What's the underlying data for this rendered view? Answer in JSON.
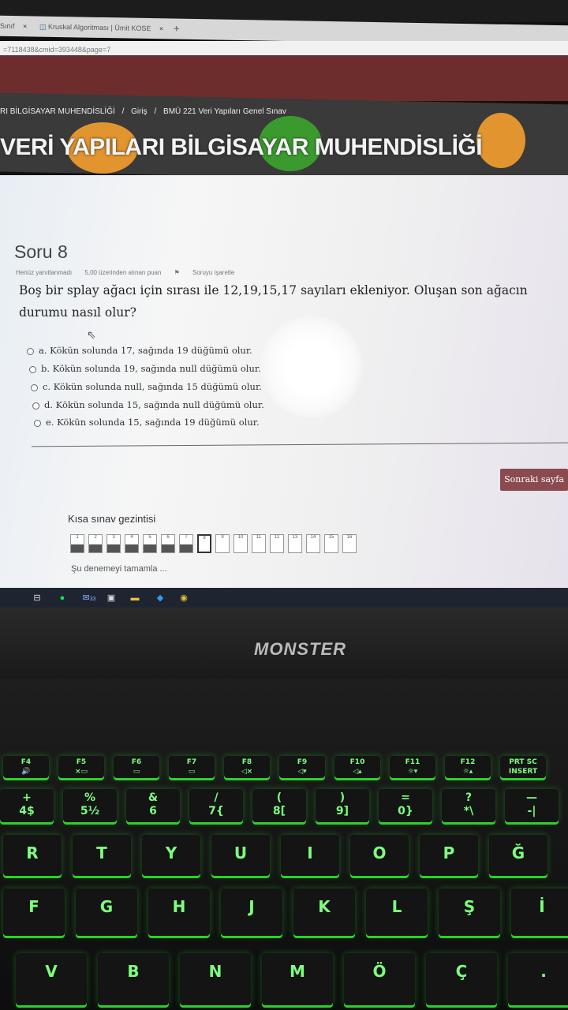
{
  "browser": {
    "tabs": [
      {
        "label": "Sınıf",
        "close": "×"
      },
      {
        "label": "Kruskal Algoritması | Ümit KOSE",
        "close": "×"
      }
    ],
    "new_tab": "+",
    "url": "=7118438&cmid=393448&page=7"
  },
  "header": {
    "breadcrumb": [
      "RI BİLGİSAYAR MUHENDİSLİĞİ",
      "/",
      "Giriş",
      "/",
      "BMÜ 221 Veri Yapıları Genel Sınav"
    ],
    "course_title": "VERİ YAPILARI BİLGİSAYAR MUHENDİSLİĞİ"
  },
  "question": {
    "title": "Soru 8",
    "status": "Henüz yanıtlanmadı",
    "points": "5,00 üzerinden alınan puan",
    "flag": "Soruyu işaretle",
    "text": "Boş bir splay ağacı için sırası ile 12,19,15,17 sayıları ekleniyor. Oluşan son ağacın durumu nasıl olur?",
    "options": [
      "a. Kökün solunda 17, sağında 19 düğümü olur.",
      "b. Kökün solunda 19, sağında null düğümü olur.",
      "c. Kökün solunda null, sağında 15 düğümü olur.",
      "d. Kökün solunda 15, sağında null düğümü olur.",
      "e. Kökün solunda 15, sağında 19 düğümü olur."
    ]
  },
  "next_button": "Sonraki sayfa",
  "quiz_nav": {
    "title": "Kısa sınav gezintisi",
    "items": [
      "1",
      "2",
      "3",
      "4",
      "5",
      "6",
      "7",
      "8",
      "9",
      "10",
      "11",
      "12",
      "13",
      "14",
      "15",
      "16"
    ],
    "answered_count": 7,
    "current": "8",
    "finish_link": "Şu denemeyi tamamla ..."
  },
  "taskbar": {
    "icons": [
      "task-view-icon",
      "spotify-icon",
      "mail-icon",
      "store-icon",
      "file-explorer-icon",
      "vscode-icon",
      "chrome-icon"
    ],
    "mail_badge": "33"
  },
  "laptop": {
    "brand": "MONSTER",
    "fkeys": [
      {
        "top": "F4",
        "bottom": "🔊"
      },
      {
        "top": "F5",
        "bottom": "×▭"
      },
      {
        "top": "F6",
        "bottom": "▭"
      },
      {
        "top": "F7",
        "bottom": "▭"
      },
      {
        "top": "F8",
        "bottom": "◁×"
      },
      {
        "top": "F9",
        "bottom": "◁▾"
      },
      {
        "top": "F10",
        "bottom": "◁▴"
      },
      {
        "top": "F11",
        "bottom": "☼▾"
      },
      {
        "top": "F12",
        "bottom": "☼▴"
      },
      {
        "top": "PRT SC",
        "bottom": "INSERT"
      }
    ],
    "num_keys": [
      {
        "top": "+",
        "bottom": "4$"
      },
      {
        "top": "%",
        "bottom": "5½"
      },
      {
        "top": "&",
        "bottom": "6"
      },
      {
        "top": "/",
        "bottom": "7{"
      },
      {
        "top": "(",
        "bottom": "8["
      },
      {
        "top": ")",
        "bottom": "9]"
      },
      {
        "top": "=",
        "bottom": "0}"
      },
      {
        "top": "?",
        "bottom": "*\\"
      },
      {
        "top": "—",
        "bottom": "-|"
      }
    ],
    "row_r": [
      "R",
      "T",
      "Y",
      "U",
      "I",
      "O",
      "P",
      "Ğ"
    ],
    "row_f": [
      "F",
      "G",
      "H",
      "J",
      "K",
      "L",
      "Ş",
      "İ"
    ],
    "row_v": [
      "V",
      "B",
      "N",
      "M",
      "Ö",
      "Ç",
      "."
    ]
  }
}
